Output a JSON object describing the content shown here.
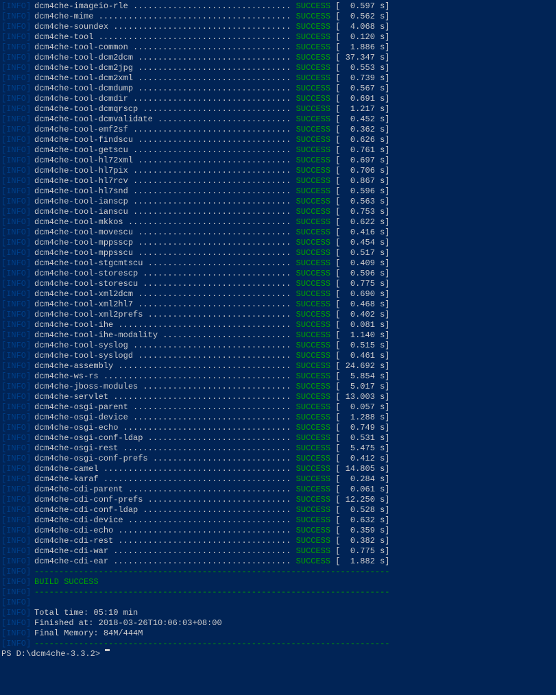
{
  "log_tag": "[INFO]",
  "modules": [
    {
      "name": "dcm4che-imageio-rle",
      "status": "SUCCESS",
      "time": "0.597"
    },
    {
      "name": "dcm4che-mime",
      "status": "SUCCESS",
      "time": "0.562"
    },
    {
      "name": "dcm4che-soundex",
      "status": "SUCCESS",
      "time": "4.068"
    },
    {
      "name": "dcm4che-tool",
      "status": "SUCCESS",
      "time": "0.120"
    },
    {
      "name": "dcm4che-tool-common",
      "status": "SUCCESS",
      "time": "1.886"
    },
    {
      "name": "dcm4che-tool-dcm2dcm",
      "status": "SUCCESS",
      "time": "37.347"
    },
    {
      "name": "dcm4che-tool-dcm2jpg",
      "status": "SUCCESS",
      "time": "0.553"
    },
    {
      "name": "dcm4che-tool-dcm2xml",
      "status": "SUCCESS",
      "time": "0.739"
    },
    {
      "name": "dcm4che-tool-dcmdump",
      "status": "SUCCESS",
      "time": "0.567"
    },
    {
      "name": "dcm4che-tool-dcmdir",
      "status": "SUCCESS",
      "time": "0.691"
    },
    {
      "name": "dcm4che-tool-dcmqrscp",
      "status": "SUCCESS",
      "time": "1.217"
    },
    {
      "name": "dcm4che-tool-dcmvalidate",
      "status": "SUCCESS",
      "time": "0.452"
    },
    {
      "name": "dcm4che-tool-emf2sf",
      "status": "SUCCESS",
      "time": "0.362"
    },
    {
      "name": "dcm4che-tool-findscu",
      "status": "SUCCESS",
      "time": "0.626"
    },
    {
      "name": "dcm4che-tool-getscu",
      "status": "SUCCESS",
      "time": "0.761"
    },
    {
      "name": "dcm4che-tool-hl72xml",
      "status": "SUCCESS",
      "time": "0.697"
    },
    {
      "name": "dcm4che-tool-hl7pix",
      "status": "SUCCESS",
      "time": "0.706"
    },
    {
      "name": "dcm4che-tool-hl7rcv",
      "status": "SUCCESS",
      "time": "0.867"
    },
    {
      "name": "dcm4che-tool-hl7snd",
      "status": "SUCCESS",
      "time": "0.596"
    },
    {
      "name": "dcm4che-tool-ianscp",
      "status": "SUCCESS",
      "time": "0.563"
    },
    {
      "name": "dcm4che-tool-ianscu",
      "status": "SUCCESS",
      "time": "0.753"
    },
    {
      "name": "dcm4che-tool-mkkos",
      "status": "SUCCESS",
      "time": "0.622"
    },
    {
      "name": "dcm4che-tool-movescu",
      "status": "SUCCESS",
      "time": "0.416"
    },
    {
      "name": "dcm4che-tool-mppsscp",
      "status": "SUCCESS",
      "time": "0.454"
    },
    {
      "name": "dcm4che-tool-mppsscu",
      "status": "SUCCESS",
      "time": "0.517"
    },
    {
      "name": "dcm4che-tool-stgcmtscu",
      "status": "SUCCESS",
      "time": "0.409"
    },
    {
      "name": "dcm4che-tool-storescp",
      "status": "SUCCESS",
      "time": "0.596"
    },
    {
      "name": "dcm4che-tool-storescu",
      "status": "SUCCESS",
      "time": "0.775"
    },
    {
      "name": "dcm4che-tool-xml2dcm",
      "status": "SUCCESS",
      "time": "0.690"
    },
    {
      "name": "dcm4che-tool-xml2hl7",
      "status": "SUCCESS",
      "time": "0.468"
    },
    {
      "name": "dcm4che-tool-xml2prefs",
      "status": "SUCCESS",
      "time": "0.402"
    },
    {
      "name": "dcm4che-tool-ihe",
      "status": "SUCCESS",
      "time": "0.081"
    },
    {
      "name": "dcm4che-tool-ihe-modality",
      "status": "SUCCESS",
      "time": "1.140"
    },
    {
      "name": "dcm4che-tool-syslog",
      "status": "SUCCESS",
      "time": "0.515"
    },
    {
      "name": "dcm4che-tool-syslogd",
      "status": "SUCCESS",
      "time": "0.461"
    },
    {
      "name": "dcm4che-assembly",
      "status": "SUCCESS",
      "time": "24.692"
    },
    {
      "name": "dcm4che-ws-rs",
      "status": "SUCCESS",
      "time": "5.854"
    },
    {
      "name": "dcm4che-jboss-modules",
      "status": "SUCCESS",
      "time": "5.017"
    },
    {
      "name": "dcm4che-servlet",
      "status": "SUCCESS",
      "time": "13.003"
    },
    {
      "name": "dcm4che-osgi-parent",
      "status": "SUCCESS",
      "time": "0.057"
    },
    {
      "name": "dcm4che-osgi-device",
      "status": "SUCCESS",
      "time": "1.288"
    },
    {
      "name": "dcm4che-osgi-echo",
      "status": "SUCCESS",
      "time": "0.749"
    },
    {
      "name": "dcm4che-osgi-conf-ldap",
      "status": "SUCCESS",
      "time": "0.531"
    },
    {
      "name": "dcm4che-osgi-rest",
      "status": "SUCCESS",
      "time": "5.475"
    },
    {
      "name": "dcm4che-osgi-conf-prefs",
      "status": "SUCCESS",
      "time": "0.412"
    },
    {
      "name": "dcm4che-camel",
      "status": "SUCCESS",
      "time": "14.805"
    },
    {
      "name": "dcm4che-karaf",
      "status": "SUCCESS",
      "time": "0.284"
    },
    {
      "name": "dcm4che-cdi-parent",
      "status": "SUCCESS",
      "time": "0.061"
    },
    {
      "name": "dcm4che-cdi-conf-prefs",
      "status": "SUCCESS",
      "time": "12.250"
    },
    {
      "name": "dcm4che-cdi-conf-ldap",
      "status": "SUCCESS",
      "time": "0.528"
    },
    {
      "name": "dcm4che-cdi-device",
      "status": "SUCCESS",
      "time": "0.632"
    },
    {
      "name": "dcm4che-cdi-echo",
      "status": "SUCCESS",
      "time": "0.359"
    },
    {
      "name": "dcm4che-cdi-rest",
      "status": "SUCCESS",
      "time": "0.382"
    },
    {
      "name": "dcm4che-cdi-war",
      "status": "SUCCESS",
      "time": "0.775"
    },
    {
      "name": "dcm4che-cdi-ear",
      "status": "SUCCESS",
      "time": "1.882"
    }
  ],
  "separator": "------------------------------------------------------------------------",
  "build_result": "BUILD SUCCESS",
  "summary": {
    "total_time": "Total time: 05:10 min",
    "finished_at": "Finished at: 2018-03-26T10:06:03+08:00",
    "final_memory": "Final Memory: 84M/444M"
  },
  "prompt": "PS D:\\dcm4che-3.3.2> ",
  "layout": {
    "name_col_width": 52,
    "time_col_width": 7
  }
}
